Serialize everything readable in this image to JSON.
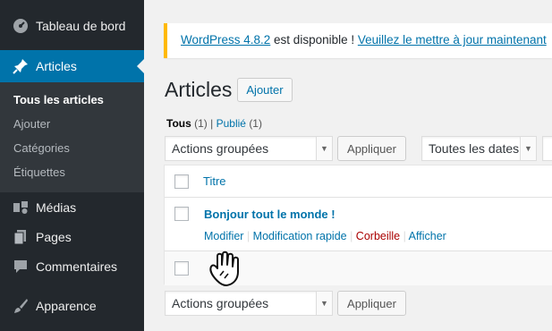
{
  "sidebar": {
    "dashboard": {
      "label": "Tableau de bord",
      "icon": "dashboard-icon"
    },
    "articles": {
      "label": "Articles",
      "icon": "pin-icon"
    },
    "articles_submenu": [
      "Tous les articles",
      "Ajouter",
      "Catégories",
      "Étiquettes"
    ],
    "media": {
      "label": "Médias",
      "icon": "media-icon"
    },
    "pages": {
      "label": "Pages",
      "icon": "pages-icon"
    },
    "comments": {
      "label": "Commentaires",
      "icon": "comments-icon"
    },
    "appearance": {
      "label": "Apparence",
      "icon": "brush-icon"
    }
  },
  "notice": {
    "link1": "WordPress 4.8.2",
    "text": " est disponible ! ",
    "link2": "Veuillez le mettre à jour maintenant"
  },
  "header": {
    "title": "Articles",
    "add_button": "Ajouter"
  },
  "filters": {
    "all_label": "Tous",
    "all_count": "(1)",
    "separator": "|",
    "published_label": "Publié",
    "published_count": "(1)"
  },
  "top_actions": {
    "bulk": "Actions groupées",
    "apply": "Appliquer",
    "dates": "Toutes les dates"
  },
  "table": {
    "column_title": "Titre",
    "rows": [
      {
        "title": "Bonjour tout le monde !",
        "actions": [
          "Modifier",
          "Modification rapide",
          "Corbeille",
          "Afficher"
        ]
      }
    ]
  },
  "bottom_actions": {
    "bulk": "Actions groupées",
    "apply": "Appliquer"
  },
  "colors": {
    "sidebar_bg": "#23282d",
    "submenu_bg": "#32373c",
    "accent": "#0073aa",
    "notice_border": "#ffb900",
    "trash": "#a00"
  }
}
